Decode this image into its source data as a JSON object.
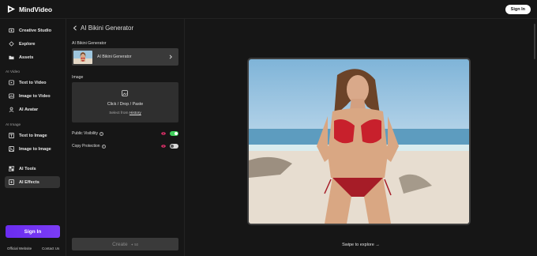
{
  "app": {
    "name": "MindVideo"
  },
  "header": {
    "signin_label": "Sign In"
  },
  "sidebar": {
    "items_top": [
      {
        "label": "Creative Studio",
        "icon": "studio-icon"
      },
      {
        "label": "Explore",
        "icon": "explore-icon"
      },
      {
        "label": "Assets",
        "icon": "assets-icon"
      }
    ],
    "section_video": "AI Video",
    "items_video": [
      {
        "label": "Text to Video",
        "icon": "text-video-icon"
      },
      {
        "label": "Image to Video",
        "icon": "image-video-icon"
      },
      {
        "label": "AI Avatar",
        "icon": "avatar-icon"
      }
    ],
    "section_image": "AI Image",
    "items_image": [
      {
        "label": "Text to Image",
        "icon": "text-image-icon"
      },
      {
        "label": "Image to Image",
        "icon": "image-image-icon"
      }
    ],
    "items_bottom": [
      {
        "label": "AI Tools",
        "icon": "tools-icon"
      },
      {
        "label": "AI Effects",
        "icon": "effects-icon",
        "active": true
      }
    ],
    "signin_label": "Sign In",
    "footer": {
      "website": "Official Website",
      "contact": "Contact Us"
    }
  },
  "panel": {
    "title": "AI Bikini Generator",
    "model_label": "AI Bikini Generator",
    "model_name": "AI Bikini Generator",
    "image_label": "Image",
    "dropzone_main": "Click / Drop / Paste",
    "dropzone_sub_prefix": "Select from",
    "dropzone_sub_link": "History",
    "public_visibility_label": "Public Visibility",
    "public_visibility_on": true,
    "copy_protection_label": "Copy Protection",
    "copy_protection_on": false,
    "create_label": "Create",
    "create_credits": "50"
  },
  "preview": {
    "swipe_label": "Swipe to explore"
  },
  "colors": {
    "accent_purple": "#6a2cf0",
    "toggle_on": "#3ecf5a",
    "eye_pink": "#e0306a"
  }
}
